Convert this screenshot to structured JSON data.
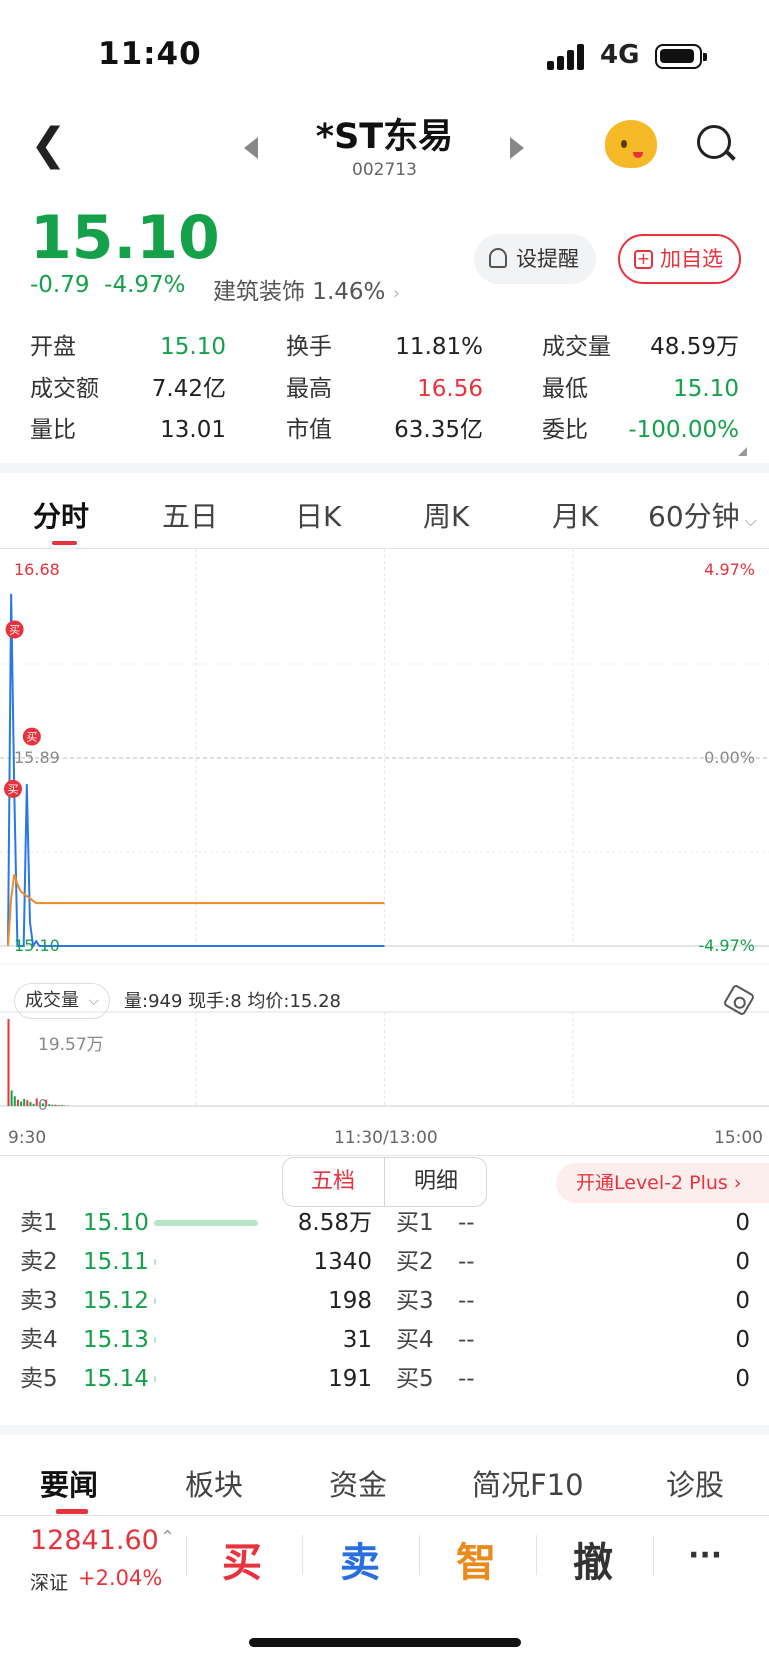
{
  "status_bar": {
    "time": "11:40",
    "network": "4G"
  },
  "header": {
    "title": "*ST东易",
    "code": "002713"
  },
  "quote": {
    "price": "15.10",
    "change": "-0.79",
    "change_pct": "-4.97%",
    "sector_label": "建筑装饰 1.46%",
    "remind_label": "设提醒",
    "add_fav_label": "加自选"
  },
  "stats": [
    {
      "label": "开盘",
      "value": "15.10",
      "color": "#14a14a"
    },
    {
      "label": "换手",
      "value": "11.81%",
      "color": "#222222"
    },
    {
      "label": "成交量",
      "value": "48.59万",
      "color": "#222222"
    },
    {
      "label": "成交额",
      "value": "7.42亿",
      "color": "#222222"
    },
    {
      "label": "最高",
      "value": "16.56",
      "color": "#e8323c"
    },
    {
      "label": "最低",
      "value": "15.10",
      "color": "#14a14a"
    },
    {
      "label": "量比",
      "value": "13.01",
      "color": "#222222"
    },
    {
      "label": "市值",
      "value": "63.35亿",
      "color": "#222222"
    },
    {
      "label": "委比",
      "value": "-100.00%",
      "color": "#14a14a"
    }
  ],
  "chart_tabs": [
    "分时",
    "五日",
    "日K",
    "周K",
    "月K",
    "60分钟"
  ],
  "chart_data": {
    "type": "line",
    "y_axis": {
      "top": "16.68",
      "mid": "15.89",
      "bottom": "15.10"
    },
    "pct_axis": {
      "top": "4.97%",
      "mid": "0.00%",
      "bottom": "-4.97%"
    },
    "x_labels": [
      "9:30",
      "11:30/13:00",
      "15:00"
    ],
    "ylim": [
      15.1,
      16.68
    ],
    "series": [
      {
        "color": "#2a78e8",
        "x": [
          0,
          1,
          2,
          3,
          4,
          5,
          6,
          7,
          8,
          9,
          10,
          11,
          12,
          120
        ],
        "values": [
          15.1,
          16.58,
          15.75,
          15.1,
          15.1,
          15.1,
          15.78,
          15.2,
          15.1,
          15.12,
          15.1,
          15.1,
          15.1,
          15.1
        ]
      },
      {
        "color": "#f08a24",
        "x": [
          0,
          1,
          2,
          3,
          4,
          5,
          6,
          7,
          8,
          9,
          10,
          120
        ],
        "values": [
          15.1,
          15.3,
          15.4,
          15.36,
          15.33,
          15.32,
          15.31,
          15.3,
          15.29,
          15.28,
          15.28,
          15.28
        ]
      }
    ],
    "markers": [
      {
        "label": "买",
        "x": 0.5,
        "value": 16.43
      },
      {
        "label": "买",
        "x": 0,
        "value": 15.76
      },
      {
        "label": "买",
        "x": 6,
        "value": 15.98
      }
    ],
    "volume": {
      "max_label": "19.57万",
      "zero_label": "0",
      "values": [
        19.57,
        3.5,
        2.2,
        1.4,
        1.0,
        1.6,
        1.3,
        0.9,
        0.5,
        1.7,
        0.8,
        0.6,
        1.4,
        0.4,
        0.3,
        0.3,
        0.2,
        0.2,
        0.1,
        0.1
      ]
    }
  },
  "volume_bar": {
    "selector": "成交量",
    "info": "量:949  现手:8  均价:15.28"
  },
  "orderbook": {
    "tab_five": "五档",
    "tab_detail": "明细",
    "level2": "开通Level-2 Plus",
    "asks": [
      {
        "label": "卖1",
        "price": "15.10",
        "vol": "8.58万",
        "bar": 1.0
      },
      {
        "label": "卖2",
        "price": "15.11",
        "vol": "1340",
        "bar": 0.02
      },
      {
        "label": "卖3",
        "price": "15.12",
        "vol": "198",
        "bar": 0.01
      },
      {
        "label": "卖4",
        "price": "15.13",
        "vol": "31",
        "bar": 0.01
      },
      {
        "label": "卖5",
        "price": "15.14",
        "vol": "191",
        "bar": 0.01
      }
    ],
    "bids": [
      {
        "label": "买1",
        "price": "--",
        "vol": "0"
      },
      {
        "label": "买2",
        "price": "--",
        "vol": "0"
      },
      {
        "label": "买3",
        "price": "--",
        "vol": "0"
      },
      {
        "label": "买4",
        "price": "--",
        "vol": "0"
      },
      {
        "label": "买5",
        "price": "--",
        "vol": "0"
      }
    ]
  },
  "bottom_tabs": [
    "要闻",
    "板块",
    "资金",
    "简况F10",
    "诊股"
  ],
  "index": {
    "value": "12841.60",
    "name": "深证",
    "change": "+2.04%"
  },
  "actions": {
    "buy": "买",
    "sell": "卖",
    "smart": "智",
    "cancel": "撤",
    "more": "···"
  }
}
